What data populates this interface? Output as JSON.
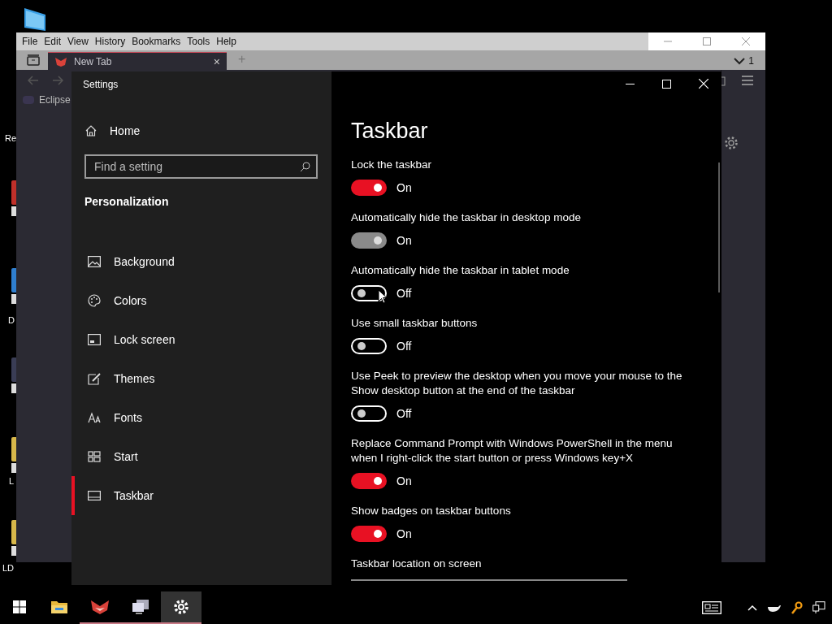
{
  "desktop": {
    "icons": [
      {
        "kind": "monitor",
        "label": "Re"
      },
      {
        "kind": "app",
        "color": "#c0302a"
      },
      {
        "kind": "app",
        "color": "#2f7fd0",
        "label": "D"
      },
      {
        "kind": "app",
        "color": "#3a3d55"
      },
      {
        "kind": "app",
        "color": "#d8b84a",
        "label": "L"
      },
      {
        "kind": "app",
        "color": "#d8b84a",
        "label": "LD"
      }
    ]
  },
  "browser": {
    "menu": [
      "File",
      "Edit",
      "View",
      "History",
      "Bookmarks",
      "Tools",
      "Help"
    ],
    "tab": {
      "label": "New Tab",
      "close": "×"
    },
    "new_tab": "+",
    "tab_count": "1",
    "bookmark": "Eclipse"
  },
  "settings": {
    "title": "Settings",
    "home": "Home",
    "search": {
      "placeholder": "Find a setting"
    },
    "section": "Personalization",
    "nav": [
      {
        "kind": "picture",
        "label": "Background",
        "selected": false
      },
      {
        "kind": "palette",
        "label": "Colors",
        "selected": false
      },
      {
        "kind": "lock",
        "label": "Lock screen",
        "selected": false
      },
      {
        "kind": "brush",
        "label": "Themes",
        "selected": false
      },
      {
        "kind": "font",
        "label": "Fonts",
        "selected": false
      },
      {
        "kind": "start",
        "label": "Start",
        "selected": false
      },
      {
        "kind": "taskbar",
        "label": "Taskbar",
        "selected": true
      }
    ],
    "page": {
      "title": "Taskbar",
      "items": [
        {
          "kind": "toggle",
          "label": "Lock the taskbar",
          "on": true,
          "disabled": false,
          "state": "On"
        },
        {
          "kind": "toggle",
          "label": "Automatically hide the taskbar in desktop mode",
          "on": true,
          "disabled": true,
          "state": "On"
        },
        {
          "kind": "toggle",
          "label": "Automatically hide the taskbar in tablet mode",
          "on": false,
          "disabled": false,
          "state": "Off"
        },
        {
          "kind": "toggle",
          "label": "Use small taskbar buttons",
          "on": false,
          "disabled": false,
          "state": "Off"
        },
        {
          "kind": "toggle",
          "label": "Use Peek to preview the desktop when you move your mouse to the Show desktop button at the end of the taskbar",
          "on": false,
          "disabled": false,
          "state": "Off"
        },
        {
          "kind": "toggle",
          "label": "Replace Command Prompt with Windows PowerShell in the menu when I right-click the start button or press Windows key+X",
          "on": true,
          "disabled": false,
          "state": "On"
        },
        {
          "kind": "toggle",
          "label": "Show badges on taskbar buttons",
          "on": true,
          "disabled": false,
          "state": "On"
        },
        {
          "kind": "dropdown",
          "label": "Taskbar location on screen"
        }
      ]
    }
  },
  "taskbar": {
    "apps": [
      {
        "kind": "folder",
        "selected": false,
        "running": false
      },
      {
        "kind": "fox",
        "selected": false,
        "running": true
      },
      {
        "kind": "computers",
        "selected": false,
        "running": true
      },
      {
        "kind": "gear",
        "selected": true,
        "running": true
      }
    ]
  }
}
